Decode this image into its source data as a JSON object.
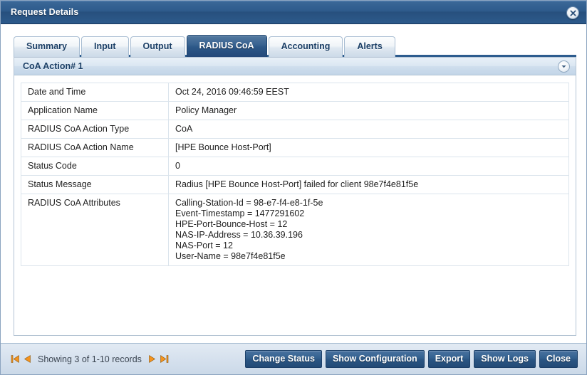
{
  "window": {
    "title": "Request Details",
    "close_icon": "close-x-icon"
  },
  "tabs": [
    {
      "label": "Summary",
      "active": false
    },
    {
      "label": "Input",
      "active": false
    },
    {
      "label": "Output",
      "active": false
    },
    {
      "label": "RADIUS CoA",
      "active": true
    },
    {
      "label": "Accounting",
      "active": false
    },
    {
      "label": "Alerts",
      "active": false
    }
  ],
  "panel": {
    "title": "CoA Action# 1",
    "collapse_icon": "chevron-down-circle-icon"
  },
  "details": [
    {
      "label": "Date and Time",
      "value": "Oct 24, 2016 09:46:59 EEST"
    },
    {
      "label": "Application Name",
      "value": "Policy Manager"
    },
    {
      "label": "RADIUS CoA Action Type",
      "value": "CoA"
    },
    {
      "label": "RADIUS CoA Action Name",
      "value": "[HPE Bounce Host-Port]"
    },
    {
      "label": "Status Code",
      "value": "0"
    },
    {
      "label": "Status Message",
      "value": "Radius [HPE Bounce Host-Port] failed for client 98e7f4e81f5e"
    },
    {
      "label": "RADIUS CoA Attributes",
      "value": "Calling-Station-Id = 98-e7-f4-e8-1f-5e\nEvent-Timestamp = 1477291602\nHPE-Port-Bounce-Host = 12\nNAS-IP-Address = 10.36.39.196\nNAS-Port = 12\nUser-Name = 98e7f4e81f5e"
    }
  ],
  "footer": {
    "pager": {
      "first_icon": "first-page-icon",
      "prev_icon": "previous-page-icon",
      "text": "Showing 3 of 1-10 records",
      "next_icon": "next-page-icon",
      "last_icon": "last-page-icon"
    },
    "buttons": [
      {
        "label": "Change Status"
      },
      {
        "label": "Show Configuration"
      },
      {
        "label": "Export"
      },
      {
        "label": "Show Logs"
      },
      {
        "label": "Close"
      }
    ]
  },
  "colors": {
    "titlebar": "#2d5a8b",
    "active_tab": "#2c5787",
    "button": "#2a5583",
    "pager_arrow": "#f5931e",
    "panel_header": "#cfdeed"
  }
}
